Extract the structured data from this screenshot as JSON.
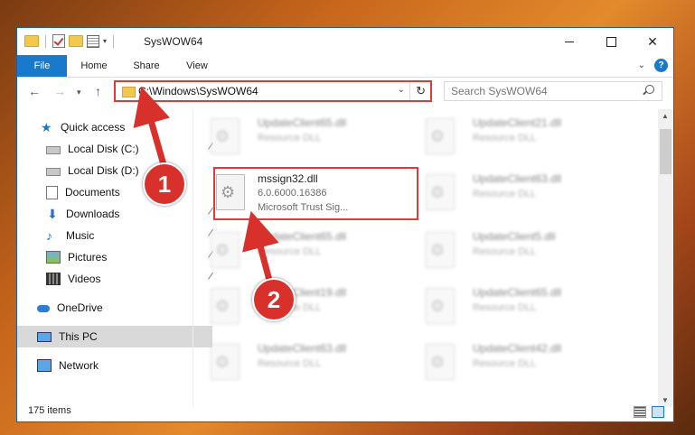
{
  "window": {
    "title": "SysWOW64"
  },
  "ribbon": {
    "tabs": [
      "File",
      "Home",
      "Share",
      "View"
    ]
  },
  "nav": {
    "address": "C:\\Windows\\SysWOW64",
    "search_placeholder": "Search SysWOW64"
  },
  "sidebar": {
    "items": [
      {
        "label": "Quick access"
      },
      {
        "label": "Local Disk (C:)"
      },
      {
        "label": "Local Disk (D:)"
      },
      {
        "label": "Documents"
      },
      {
        "label": "Downloads"
      },
      {
        "label": "Music"
      },
      {
        "label": "Pictures"
      },
      {
        "label": "Videos"
      },
      {
        "label": "OneDrive"
      },
      {
        "label": "This PC"
      },
      {
        "label": "Network"
      }
    ]
  },
  "files": {
    "highlighted": {
      "name": "mssign32.dll",
      "version": "6.0.6000.16386",
      "description": "Microsoft Trust Sig..."
    },
    "left": [
      {
        "name": "UpdateClient65.dll",
        "desc": "Resource DLL"
      },
      {
        "name": "UpdateClient65.dll",
        "desc": "Resource DLL"
      },
      {
        "name": "UpdateClient19.dll",
        "desc": "Resource DLL"
      },
      {
        "name": "UpdateClient63.dll",
        "desc": "Resource DLL"
      }
    ],
    "right": [
      {
        "name": "UpdateClient21.dll",
        "desc": "Resource DLL"
      },
      {
        "name": "UpdateClient63.dll",
        "desc": "Resource DLL"
      },
      {
        "name": "UpdateClient5.dll",
        "desc": "Resource DLL"
      },
      {
        "name": "UpdateClient65.dll",
        "desc": "Resource DLL"
      },
      {
        "name": "UpdateClient42.dll",
        "desc": "Resource DLL"
      }
    ]
  },
  "status": {
    "count": "175 items"
  },
  "annotations": {
    "step1": "1",
    "step2": "2",
    "color": "#e23a3a"
  }
}
